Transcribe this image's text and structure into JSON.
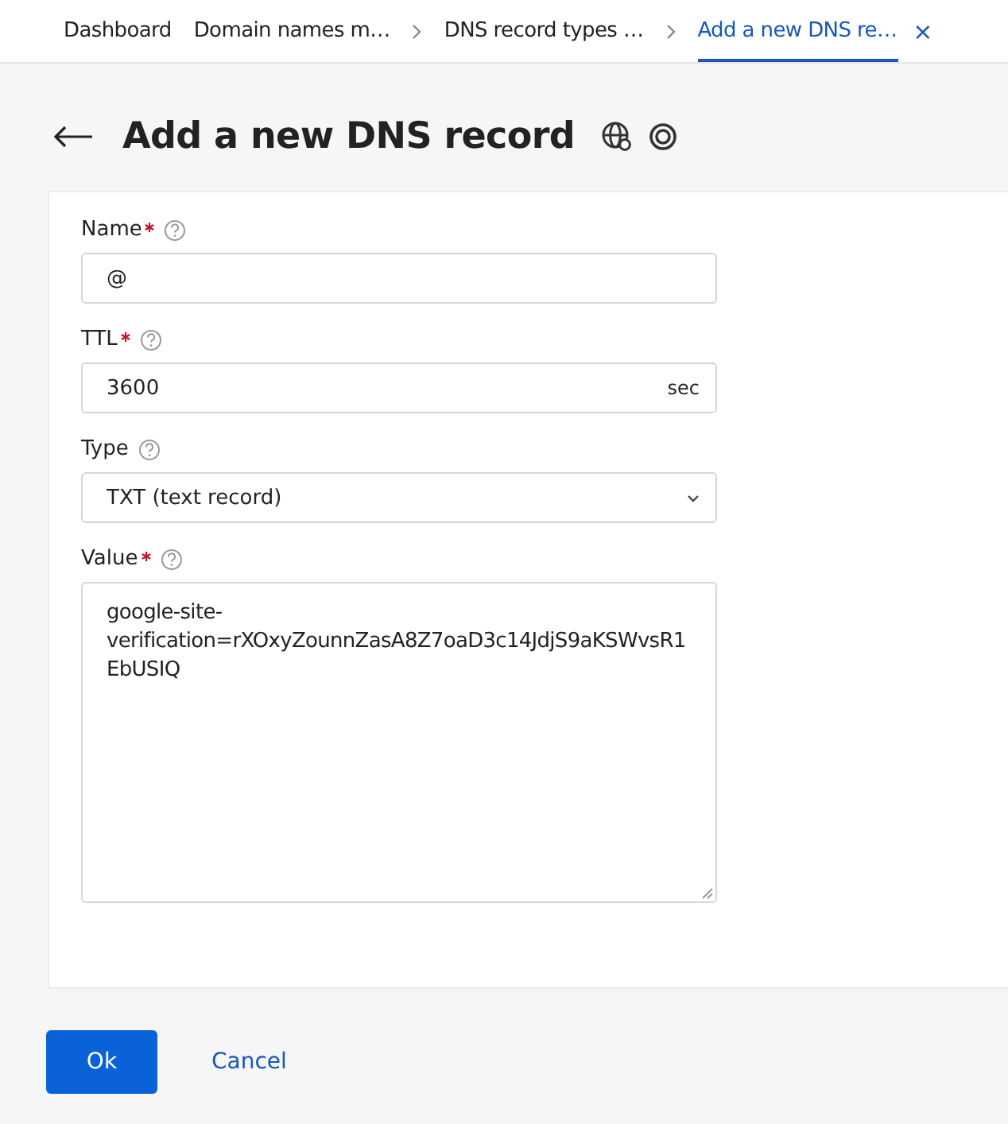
{
  "tabs": [
    {
      "label": "Dashboard",
      "selected": false,
      "separator": false,
      "closable": false
    },
    {
      "label": "Domain names m…",
      "selected": false,
      "separator": false,
      "closable": false
    },
    {
      "label": "DNS record types …",
      "selected": false,
      "separator": true,
      "closable": false
    },
    {
      "label": "Add a new DNS re…",
      "selected": true,
      "separator": true,
      "closable": true
    }
  ],
  "close_tab": "×",
  "page_title": "Add a new DNS record",
  "fields": [
    {
      "kind": "text",
      "label": "Name",
      "required": true,
      "value": "@"
    },
    {
      "kind": "unit",
      "label": "TTL",
      "required": true,
      "value": "3600",
      "unit": "sec"
    },
    {
      "kind": "select",
      "label": "Type",
      "required": false,
      "value": "TXT (text record)"
    },
    {
      "kind": "textarea",
      "label": "Value",
      "required": true,
      "value": "google-site-verification=rXOxyZounnZasA8Z7oaD3c14JdjS9aKSWvsR1EbUSIQ"
    }
  ],
  "buttons": [
    {
      "label": "Ok",
      "primary": true
    },
    {
      "label": "Cancel",
      "primary": false
    }
  ]
}
